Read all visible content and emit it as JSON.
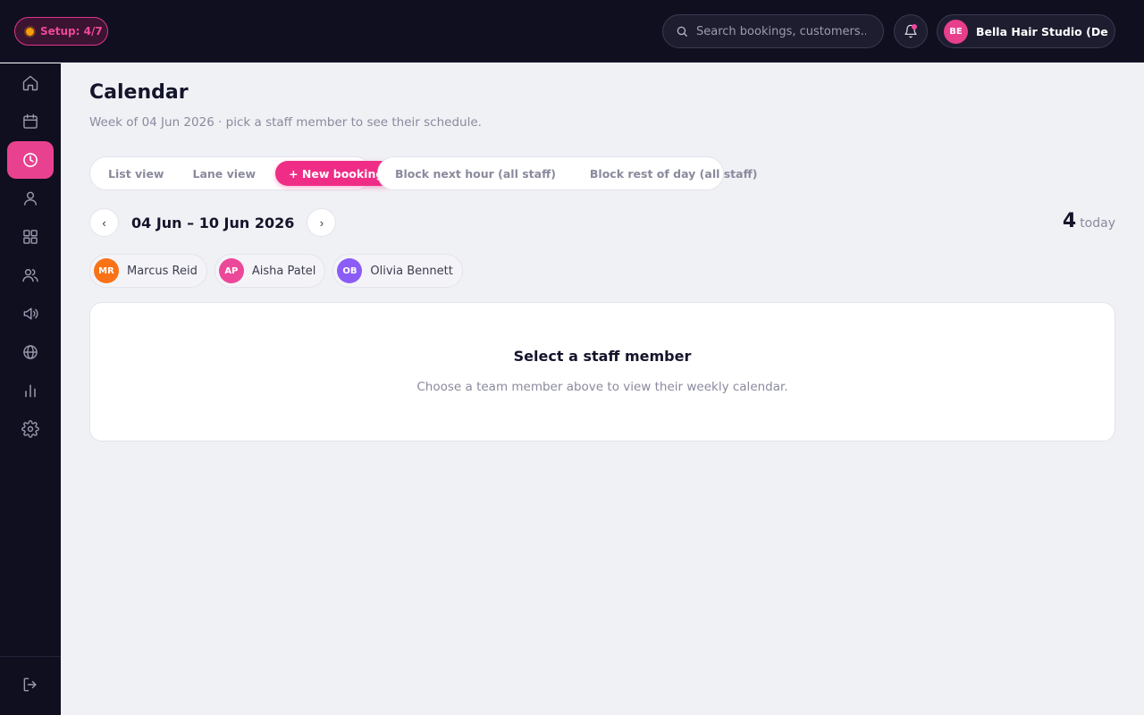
{
  "topbar": {
    "setup_label": "Setup: 4/7",
    "search_placeholder": "Search bookings, customers...",
    "account": {
      "initials": "BE",
      "name": "Bella Hair Studio (De...",
      "avatar_color": "#e83e8c"
    }
  },
  "sidebar": {
    "items": [
      {
        "icon": "home-icon"
      },
      {
        "icon": "calendar-icon"
      },
      {
        "icon": "clock-icon",
        "active": true
      },
      {
        "icon": "user-icon"
      },
      {
        "icon": "grid-icon"
      },
      {
        "icon": "users-icon"
      },
      {
        "icon": "megaphone-icon"
      },
      {
        "icon": "globe-icon"
      },
      {
        "icon": "bar-chart-icon"
      },
      {
        "icon": "gear-icon"
      }
    ],
    "bottom_icon": "logout-icon"
  },
  "page": {
    "title": "Calendar",
    "subtitle": "Week of 04 Jun 2026 · pick a staff member to see their schedule."
  },
  "toolbar": {
    "list_view": "List view",
    "lane_view": "Lane view",
    "new_booking": "+ New booking",
    "block_next_hour": "Block next hour (all staff)",
    "block_rest_of_day": "Block rest of day (all staff)"
  },
  "week_nav": {
    "prev": "‹",
    "label": "04 Jun – 10 Jun 2026",
    "next": "›"
  },
  "today": {
    "count": "4",
    "label": "today"
  },
  "staff": [
    {
      "initials": "MR",
      "name": "Marcus Reid",
      "color": "#f97316"
    },
    {
      "initials": "AP",
      "name": "Aisha Patel",
      "color": "#ec4899"
    },
    {
      "initials": "OB",
      "name": "Olivia Bennett",
      "color": "#8b5cf6"
    }
  ],
  "empty_state": {
    "title": "Select a staff member",
    "text": "Choose a team member above to view their weekly calendar."
  },
  "colors": {
    "accent": "#ef2d87",
    "nav_background": "#100f1f"
  }
}
